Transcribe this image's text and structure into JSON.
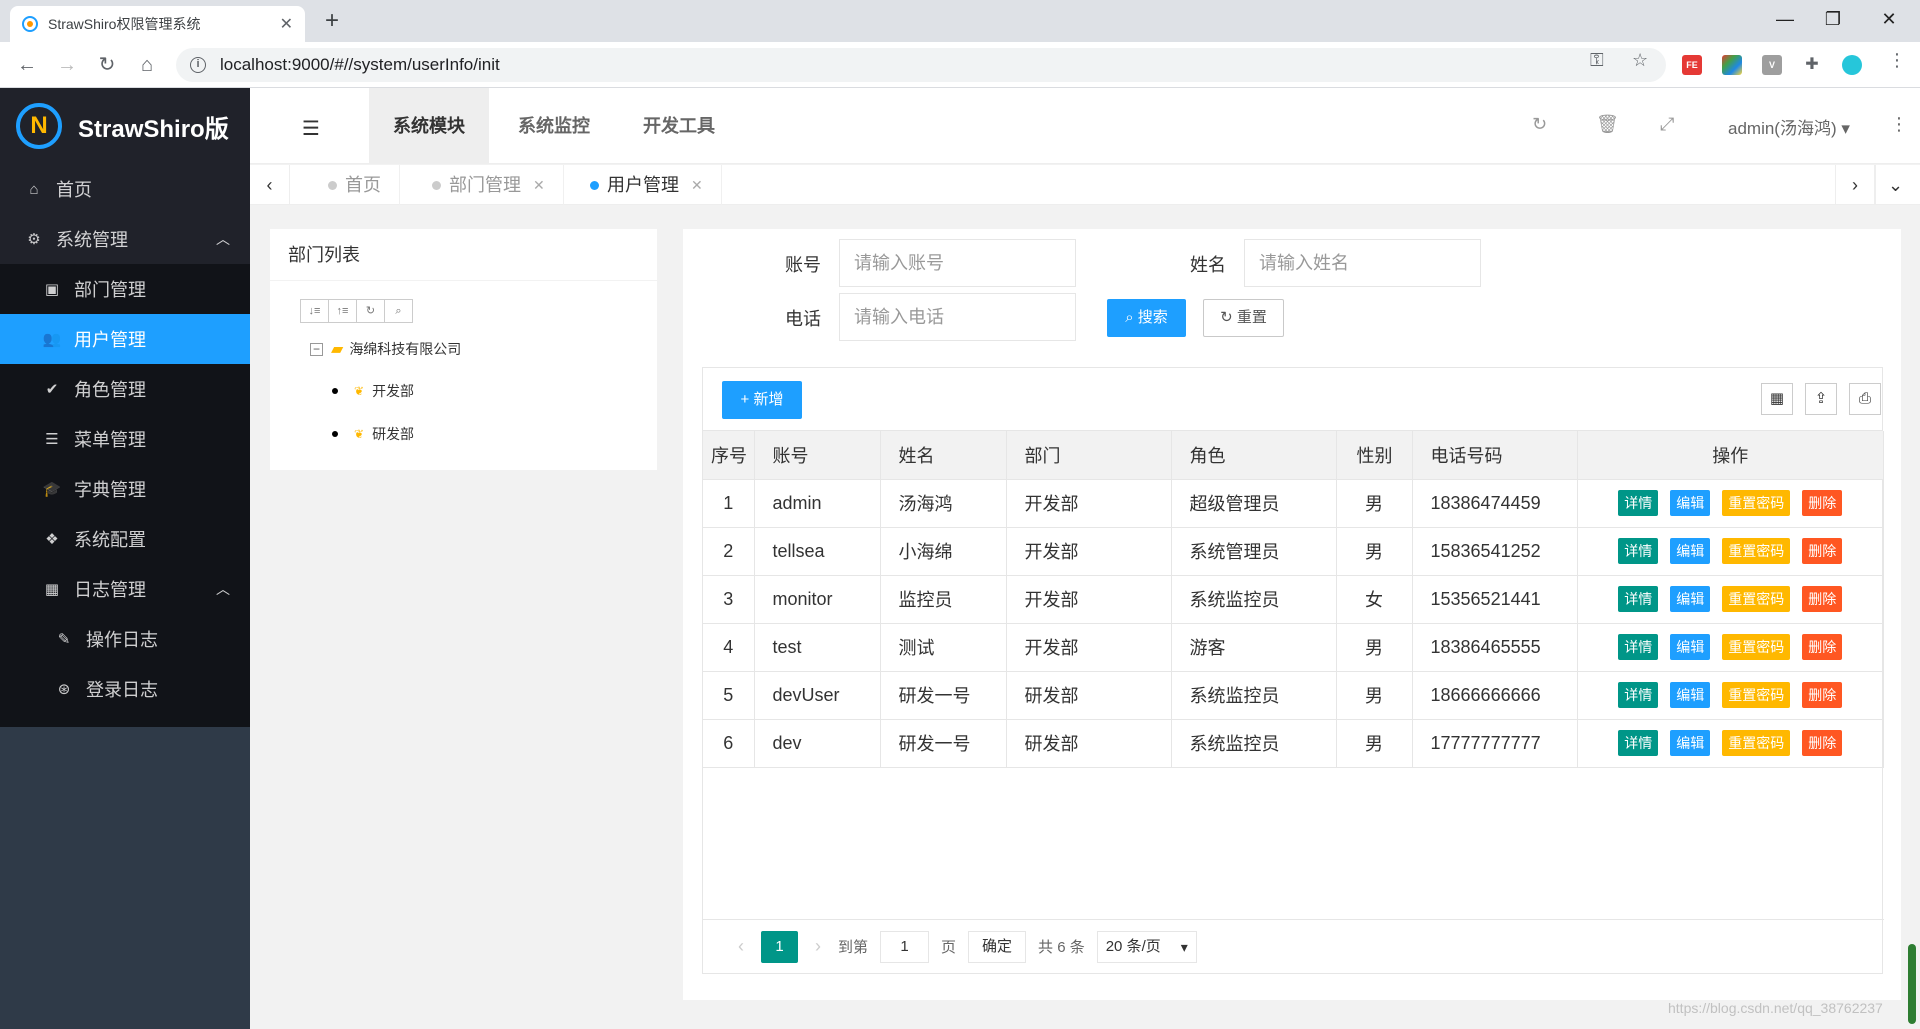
{
  "browser": {
    "tab_title": "StrawShiro权限管理系统",
    "tab_close": "✕",
    "new_tab": "+",
    "url": "localhost:9000/#//system/userInfo/init",
    "ext_fe": "FE"
  },
  "app": {
    "logo_text": "StrawShiro版",
    "menu": {
      "home": "首页",
      "system": "系统管理",
      "dept": "部门管理",
      "user": "用户管理",
      "role": "角色管理",
      "menu": "菜单管理",
      "dict": "字典管理",
      "config": "系统配置",
      "log": "日志管理",
      "oplog": "操作日志",
      "loginlog": "登录日志"
    },
    "header": {
      "tabs": [
        "系统模块",
        "系统监控",
        "开发工具"
      ],
      "user": "admin(汤海鸿)"
    },
    "page_tabs": {
      "home": "首页",
      "dept": "部门管理",
      "user": "用户管理"
    }
  },
  "dept_panel": {
    "title": "部门列表",
    "root": "海绵科技有限公司",
    "children": [
      "开发部",
      "研发部"
    ]
  },
  "search": {
    "account_label": "账号",
    "account_placeholder": "请输入账号",
    "name_label": "姓名",
    "name_placeholder": "请输入姓名",
    "phone_label": "电话",
    "phone_placeholder": "请输入电话",
    "search_btn": "搜索",
    "reset_btn": "重置"
  },
  "toolbar": {
    "add_btn": "新增"
  },
  "table": {
    "headers": [
      "序号",
      "账号",
      "姓名",
      "部门",
      "角色",
      "性别",
      "电话号码",
      "操作"
    ],
    "ops": [
      "详情",
      "编辑",
      "重置密码",
      "删除"
    ],
    "rows": [
      [
        "1",
        "admin",
        "汤海鸿",
        "开发部",
        "超级管理员",
        "男",
        "18386474459"
      ],
      [
        "2",
        "tellsea",
        "小海绵",
        "开发部",
        "系统管理员",
        "男",
        "15836541252"
      ],
      [
        "3",
        "monitor",
        "监控员",
        "开发部",
        "系统监控员",
        "女",
        "15356521441"
      ],
      [
        "4",
        "test",
        "测试",
        "开发部",
        "游客",
        "男",
        "18386465555"
      ],
      [
        "5",
        "devUser",
        "研发一号",
        "研发部",
        "系统监控员",
        "男",
        "18666666666"
      ],
      [
        "6",
        "dev",
        "研发一号",
        "研发部",
        "系统监控员",
        "男",
        "17777777777"
      ]
    ]
  },
  "pager": {
    "current": "1",
    "goto_label": "到第",
    "goto_value": "1",
    "page_unit": "页",
    "confirm": "确定",
    "total": "共 6 条",
    "page_size": "20 条/页"
  },
  "watermark": "https://blog.csdn.net/qq_38762237"
}
